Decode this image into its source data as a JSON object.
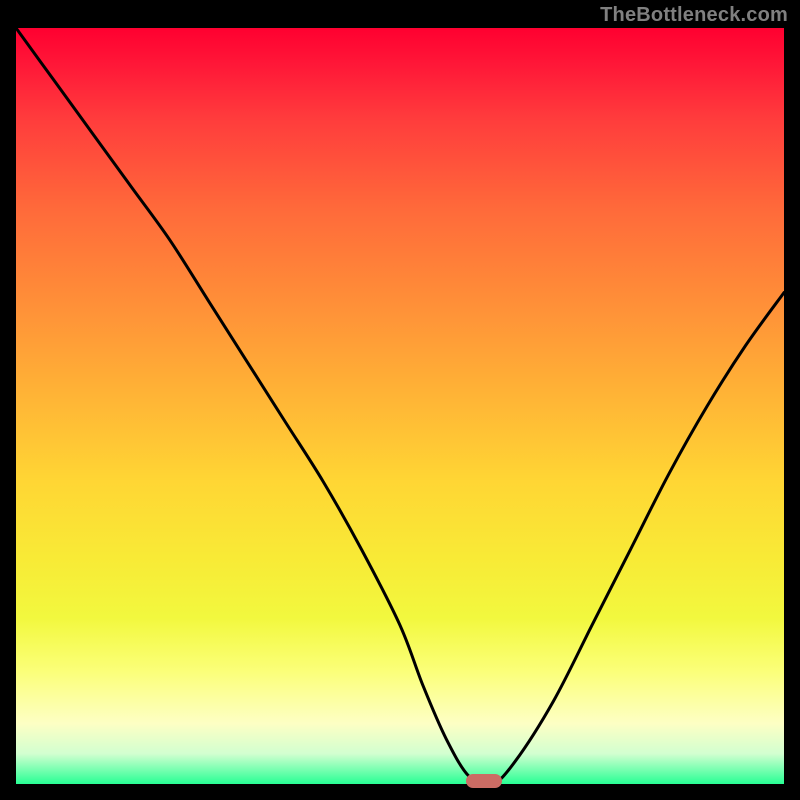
{
  "watermark": "TheBottleneck.com",
  "chart_data": {
    "type": "line",
    "title": "",
    "xlabel": "",
    "ylabel": "",
    "xlim": [
      0,
      100
    ],
    "ylim": [
      0,
      100
    ],
    "grid": false,
    "legend": false,
    "series": [
      {
        "name": "bottleneck-curve",
        "x": [
          0,
          5,
          10,
          15,
          20,
          25,
          30,
          35,
          40,
          45,
          50,
          53,
          56,
          59,
          62,
          65,
          70,
          75,
          80,
          85,
          90,
          95,
          100
        ],
        "y": [
          100,
          93,
          86,
          79,
          72,
          64,
          56,
          48,
          40,
          31,
          21,
          13,
          6,
          1,
          0,
          3,
          11,
          21,
          31,
          41,
          50,
          58,
          65
        ]
      }
    ],
    "marker": {
      "x": 61,
      "y": 0,
      "color": "#cb6c64"
    },
    "background_gradient": {
      "top": "#ff0030",
      "mid": "#ffd634",
      "bottom": "#28ff94"
    },
    "curve_color": "#000000"
  }
}
